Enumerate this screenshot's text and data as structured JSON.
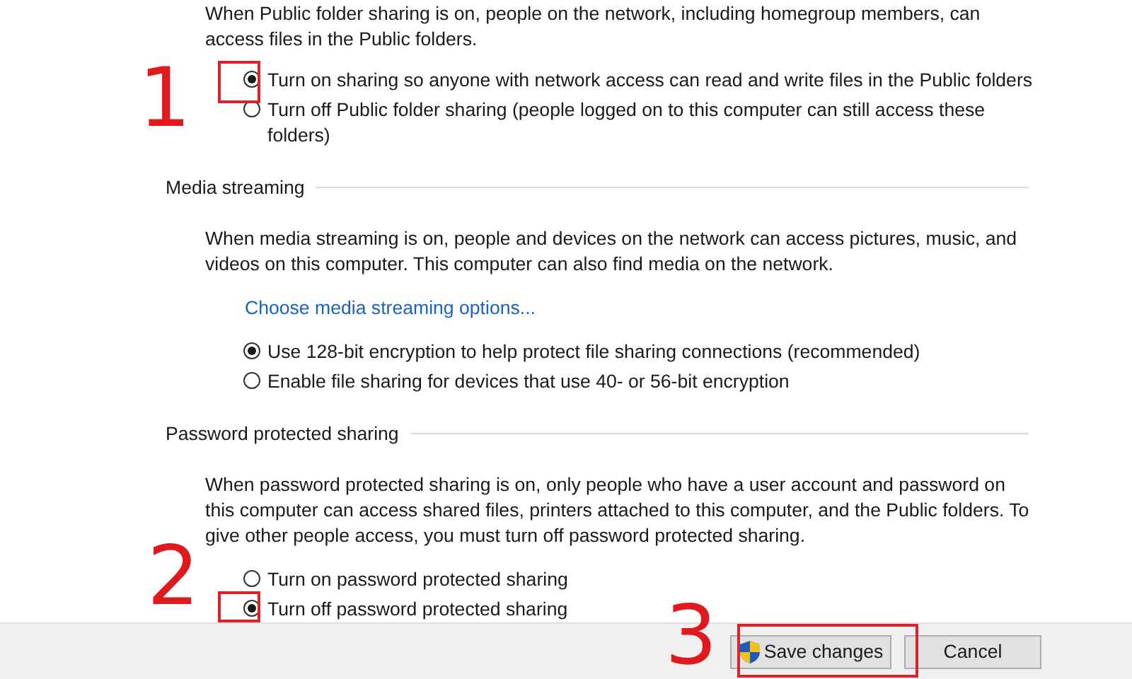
{
  "sections": [
    {
      "description": "When Public folder sharing is on, people on the network, including homegroup members, can access files in the Public folders.",
      "options": [
        {
          "label": "Turn on sharing so anyone with network access can read and write files in the Public folders",
          "selected": true
        },
        {
          "label": "Turn off Public folder sharing (people logged on to this computer can still access these folders)",
          "selected": false
        }
      ]
    },
    {
      "heading": "Media streaming",
      "description": "When media streaming is on, people and devices on the network can access pictures, music, and videos on this computer. This computer can also find media on the network.",
      "link": "Choose media streaming options...",
      "options": [
        {
          "label": "Use 128-bit encryption to help protect file sharing connections (recommended)",
          "selected": true
        },
        {
          "label": "Enable file sharing for devices that use 40- or 56-bit encryption",
          "selected": false
        }
      ]
    },
    {
      "heading": "Password protected sharing",
      "description": "When password protected sharing is on, only people who have a user account and password on this computer can access shared files, printers attached to this computer, and the Public folders. To give other people access, you must turn off password protected sharing.",
      "options": [
        {
          "label": "Turn on password protected sharing",
          "selected": false
        },
        {
          "label": "Turn off password protected sharing",
          "selected": true
        }
      ]
    }
  ],
  "buttons": [
    {
      "label": "Save changes",
      "kind": "shield"
    },
    {
      "label": "Cancel",
      "kind": "plain"
    }
  ],
  "annotations": [
    {
      "label": "1"
    },
    {
      "label": "2"
    },
    {
      "label": "3"
    }
  ]
}
